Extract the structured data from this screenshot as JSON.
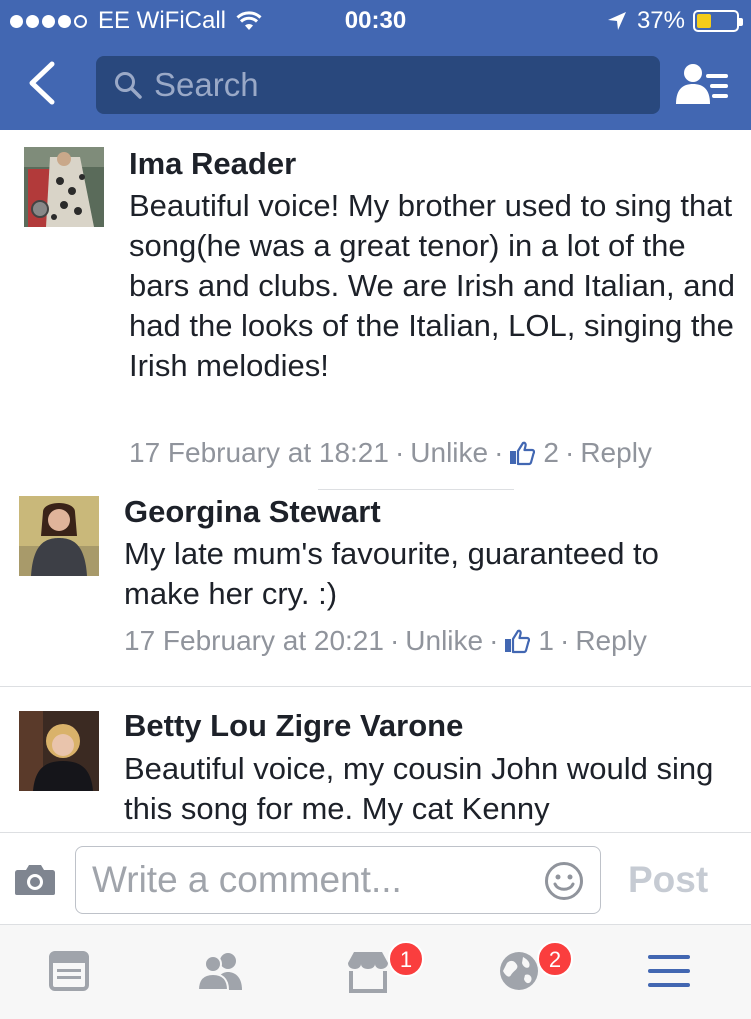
{
  "status_bar": {
    "carrier": "EE WiFiCall",
    "time": "00:30",
    "battery": "37%",
    "battery_level": 0.37,
    "signal_icon": "signal-dots-icon",
    "wifi_icon": "wifi-icon",
    "location_icon": "location-arrow-icon"
  },
  "header": {
    "search_placeholder": "Search",
    "back_icon": "chevron-left-icon",
    "friends_icon": "friend-list-icon",
    "background_color": "#4267b2"
  },
  "comments": [
    {
      "name": "Ima Reader",
      "text": "Beautiful voice!  My brother used to sing that song(he was a great tenor) in a lot of the bars and clubs.  We are Irish and Italian, and had the looks of the Italian, LOL, singing the Irish melodies!",
      "timestamp": "17 February at 18:21",
      "unlike": "Unlike",
      "likes": "2",
      "reply": "Reply"
    },
    {
      "name": "Georgina Stewart",
      "text": "My late mum's favourite, guaranteed to make her cry. :)",
      "timestamp": "17 February at 20:21",
      "unlike": "Unlike",
      "likes": "1",
      "reply": "Reply"
    },
    {
      "name": "Betty Lou Zigre Varone",
      "text": "Beautiful voice, my cousin John would sing this song for me.  My cat Kenny"
    }
  ],
  "composer": {
    "placeholder": "Write a comment...",
    "post_label": "Post",
    "camera_icon": "camera-icon",
    "emoji_icon": "smiley-icon"
  },
  "tabbar": {
    "tabs": [
      {
        "icon": "news-feed-icon"
      },
      {
        "icon": "friends-icon"
      },
      {
        "icon": "marketplace-icon",
        "badge": "1"
      },
      {
        "icon": "notifications-globe-icon",
        "badge": "2"
      },
      {
        "icon": "menu-icon",
        "active": true
      }
    ],
    "active_color": "#4267b2"
  }
}
